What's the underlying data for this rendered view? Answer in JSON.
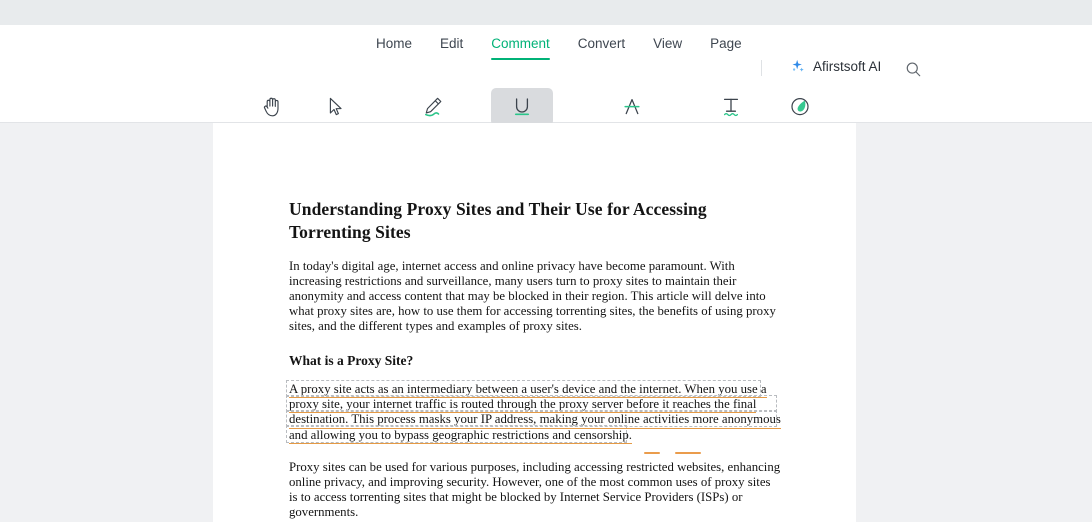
{
  "app": {
    "brand": "Afirstsoft AI",
    "accent_green": "#00b277",
    "annotation_orange": "#e59a45"
  },
  "menubar": {
    "tabs": [
      {
        "label": "Home",
        "active": false
      },
      {
        "label": "Edit",
        "active": false
      },
      {
        "label": "Comment",
        "active": true
      },
      {
        "label": "Convert",
        "active": false
      },
      {
        "label": "View",
        "active": false
      },
      {
        "label": "Page",
        "active": false
      }
    ],
    "ai_button_label": "Afirstsoft AI",
    "ai_icon": "sparkle-icon",
    "search_icon": "search-icon"
  },
  "toolbar": {
    "tools": [
      {
        "label": "Hand",
        "icon": "hand-icon",
        "caret": false,
        "active": false
      },
      {
        "label": "Select",
        "icon": "cursor-arrow-icon",
        "caret": false,
        "active": false
      },
      {
        "label": "Highlight",
        "icon": "highlight-pen-icon",
        "caret": true,
        "active": false
      },
      {
        "label": "Underline",
        "icon": "underline-icon",
        "caret": true,
        "active": true
      },
      {
        "label": "Strikethrough",
        "icon": "strikethrough-icon",
        "caret": true,
        "active": false
      },
      {
        "label": "Tilde",
        "icon": "tilde-icon",
        "caret": true,
        "active": false
      },
      {
        "label": "Sticker",
        "icon": "sticker-icon",
        "caret": false,
        "active": false
      }
    ]
  },
  "document": {
    "title": "Understanding Proxy Sites and Their Use for Accessing Torrenting Sites",
    "intro_paragraph": "In today's digital age, internet access and online privacy have become paramount. With increasing restrictions and surveillance, many users turn to proxy sites to maintain their anonymity and access content that may be blocked in their region. This article will delve into what proxy sites are, how to use them for accessing torrenting sites, the benefits of using proxy sites, and the different types and examples of proxy sites.",
    "section_heading": "What is a Proxy Site?",
    "annotated_lines": [
      "A proxy site acts as an intermediary between a user's device and the internet. When you use a",
      "proxy site, your internet traffic is routed through the proxy server before it reaches the final",
      "destination. This process masks your IP address, making your online activities more anonymous",
      "and allowing you to bypass geographic restrictions and censorship."
    ],
    "closing_paragraph": "Proxy sites can be used for various purposes, including accessing restricted websites, enhancing online privacy, and improving security. However, one of the most common uses of proxy sites is to access torrenting sites that might be blocked by Internet Service Providers (ISPs) or governments."
  }
}
